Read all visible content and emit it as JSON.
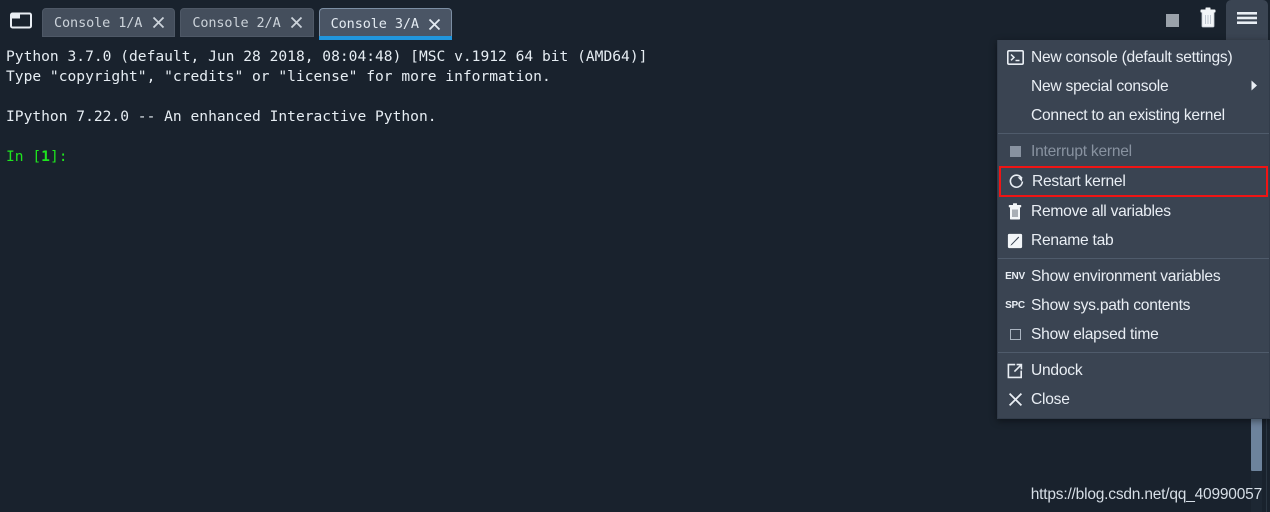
{
  "window": {
    "app": "Spyder IPython Console"
  },
  "toolbar": {
    "browse_icon": "browse-tabs-icon",
    "tabs": [
      {
        "label": "Console 1/A",
        "active": false,
        "close_icon": "close-icon"
      },
      {
        "label": "Console 2/A",
        "active": false,
        "close_icon": "close-icon"
      },
      {
        "label": "Console 3/A",
        "active": true,
        "close_icon": "close-icon"
      }
    ],
    "buttons": [
      {
        "name": "interrupt-kernel-button",
        "icon": "stop-square-icon",
        "label": ""
      },
      {
        "name": "remove-all-variables-button",
        "icon": "trash-icon",
        "label": ""
      },
      {
        "name": "options-menu-button",
        "icon": "hamburger-icon",
        "label": ""
      }
    ]
  },
  "console": {
    "lines": [
      "Python 3.7.0 (default, Jun 28 2018, 08:04:48) [MSC v.1912 64 bit (AMD64)]",
      "Type \"copyright\", \"credits\" or \"license\" for more information.",
      "",
      "IPython 7.22.0 -- An enhanced Interactive Python.",
      ""
    ],
    "prompt_prefix": "In [",
    "prompt_number": "1",
    "prompt_suffix": "]:",
    "prompt_color": "#1ee51e"
  },
  "menu": {
    "items": [
      {
        "label": "New console (default settings)",
        "icon": "terminal-icon",
        "disabled": false,
        "submenu": false,
        "highlighted": false
      },
      {
        "label": "New special console",
        "icon": "none",
        "disabled": false,
        "submenu": true,
        "highlighted": false
      },
      {
        "label": "Connect to an existing kernel",
        "icon": "none",
        "disabled": false,
        "submenu": false,
        "highlighted": false
      },
      {
        "separator": true
      },
      {
        "label": "Interrupt kernel",
        "icon": "stop-square-icon",
        "disabled": true,
        "submenu": false,
        "highlighted": false
      },
      {
        "label": "Restart kernel",
        "icon": "restart-icon",
        "disabled": false,
        "submenu": false,
        "highlighted": true
      },
      {
        "label": "Remove all variables",
        "icon": "trash-icon",
        "disabled": false,
        "submenu": false,
        "highlighted": false
      },
      {
        "label": "Rename tab",
        "icon": "rename-icon",
        "disabled": false,
        "submenu": false,
        "highlighted": false
      },
      {
        "separator": true
      },
      {
        "label": "Show environment variables",
        "icon": "ENV",
        "disabled": false,
        "submenu": false,
        "highlighted": false
      },
      {
        "label": "Show sys.path contents",
        "icon": "SPC",
        "disabled": false,
        "submenu": false,
        "highlighted": false
      },
      {
        "label": "Show elapsed time",
        "icon": "checkbox-icon",
        "disabled": false,
        "submenu": false,
        "highlighted": false
      },
      {
        "separator": true
      },
      {
        "label": "Undock",
        "icon": "undock-icon",
        "disabled": false,
        "submenu": false,
        "highlighted": false
      },
      {
        "label": "Close",
        "icon": "close-x-icon",
        "disabled": false,
        "submenu": false,
        "highlighted": false
      }
    ],
    "highlight_color": "#f01414"
  },
  "watermark": {
    "text": "https://blog.csdn.net/qq_40990057"
  },
  "colors": {
    "console_bg": "#19222d",
    "menu_bg": "#3a4452",
    "tab_bg": "#444e5c",
    "active_tab_underline": "#2196dd",
    "text": "#e6edf3"
  }
}
